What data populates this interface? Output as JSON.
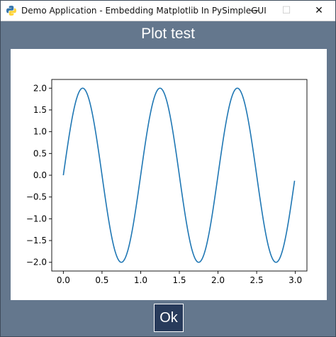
{
  "window": {
    "title": "Demo Application - Embedding Matplotlib In PySimpleGUI",
    "controls": {
      "minimize": "—",
      "maximize": "☐",
      "close": "✕"
    }
  },
  "heading": "Plot test",
  "ok_button": {
    "label": "Ok"
  },
  "colors": {
    "background": "#64778d",
    "button_bg": "#283b5b",
    "line": "#1f77b4"
  },
  "chart_data": {
    "type": "line",
    "function": "2*sin(2*pi*x)",
    "x_start": 0.0,
    "x_end": 2.99,
    "x_step": 0.01,
    "xlim": [
      -0.15,
      3.15
    ],
    "ylim": [
      -2.2,
      2.2
    ],
    "xticks": [
      0.0,
      0.5,
      1.0,
      1.5,
      2.0,
      2.5,
      3.0
    ],
    "xtick_labels": [
      "0.0",
      "0.5",
      "1.0",
      "1.5",
      "2.0",
      "2.5",
      "3.0"
    ],
    "yticks": [
      2.0,
      1.5,
      1.0,
      0.5,
      0.0,
      -0.5,
      -1.0,
      -1.5,
      -2.0
    ],
    "ytick_labels": [
      "2.0",
      "1.5",
      "1.0",
      "0.5",
      "0.0",
      "−0.5",
      "−1.0",
      "−1.5",
      "−2.0"
    ],
    "grid": false
  }
}
